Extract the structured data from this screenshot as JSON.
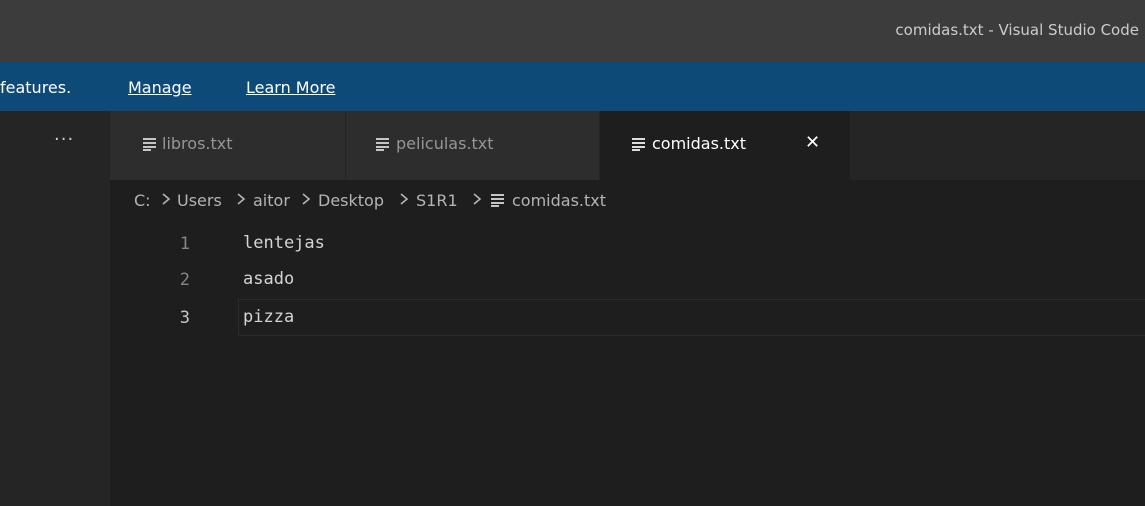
{
  "window": {
    "title": "comidas.txt - Visual Studio Code"
  },
  "banner": {
    "message": "features.",
    "manage_label": "Manage",
    "learn_more_label": "Learn More"
  },
  "activitybar": {
    "overflow_glyph": "···"
  },
  "tabs": [
    {
      "label": "libros.txt",
      "icon": "text-file-icon",
      "active": false
    },
    {
      "label": "peliculas.txt",
      "icon": "text-file-icon",
      "active": false
    },
    {
      "label": "comidas.txt",
      "icon": "text-file-icon",
      "active": true,
      "close_glyph": "✕"
    }
  ],
  "breadcrumb": {
    "segments": [
      "C:",
      "Users",
      "aitor",
      "Desktop",
      "S1R1"
    ],
    "file": "comidas.txt",
    "separator_icon": "chevron-right-icon",
    "file_icon": "text-file-icon"
  },
  "editor": {
    "lines": [
      {
        "number": "1",
        "text": "lentejas"
      },
      {
        "number": "2",
        "text": "asado"
      },
      {
        "number": "3",
        "text": "pizza"
      }
    ],
    "current_line": 3
  },
  "colors": {
    "titlebar_bg": "#3c3c3c",
    "banner_bg": "#0e4a78",
    "editor_bg": "#1e1e1e",
    "tab_inactive_bg": "#2d2d2d",
    "sidebar_bg": "#252526"
  }
}
